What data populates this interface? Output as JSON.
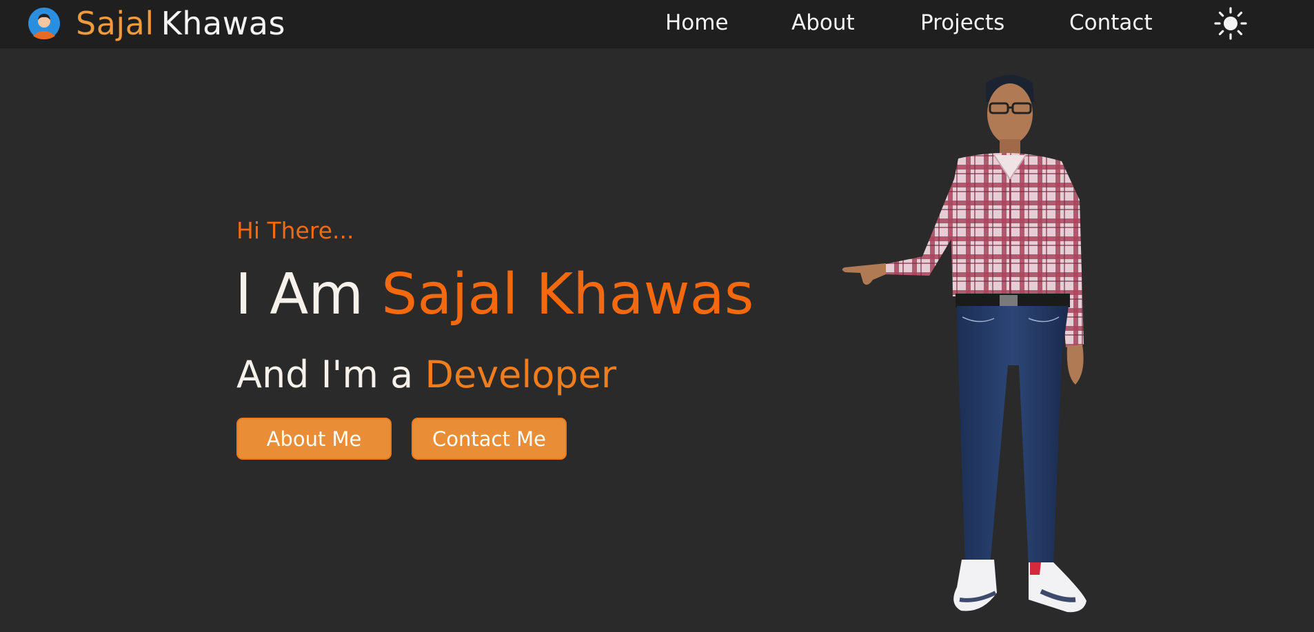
{
  "brand": {
    "first_name": "Sajal",
    "last_name": "Khawas",
    "avatar_icon": "user-avatar-icon"
  },
  "nav": {
    "items": [
      {
        "label": "Home"
      },
      {
        "label": "About"
      },
      {
        "label": "Projects"
      },
      {
        "label": "Contact"
      }
    ],
    "theme_icon": "sun-icon"
  },
  "hero": {
    "greeting": "Hi There...",
    "title_prefix": "I Am ",
    "title_highlight": "Sajal Khawas",
    "subtitle_prefix": "And I'm a ",
    "subtitle_highlight": "Developer",
    "buttons": {
      "about_label": "About Me",
      "contact_label": "Contact Me"
    }
  },
  "colors": {
    "background": "#2a2a2a",
    "navbar": "#1f1f1f",
    "accent": "#f4680e",
    "button": "#e98d37",
    "text": "#f4f4f4"
  }
}
